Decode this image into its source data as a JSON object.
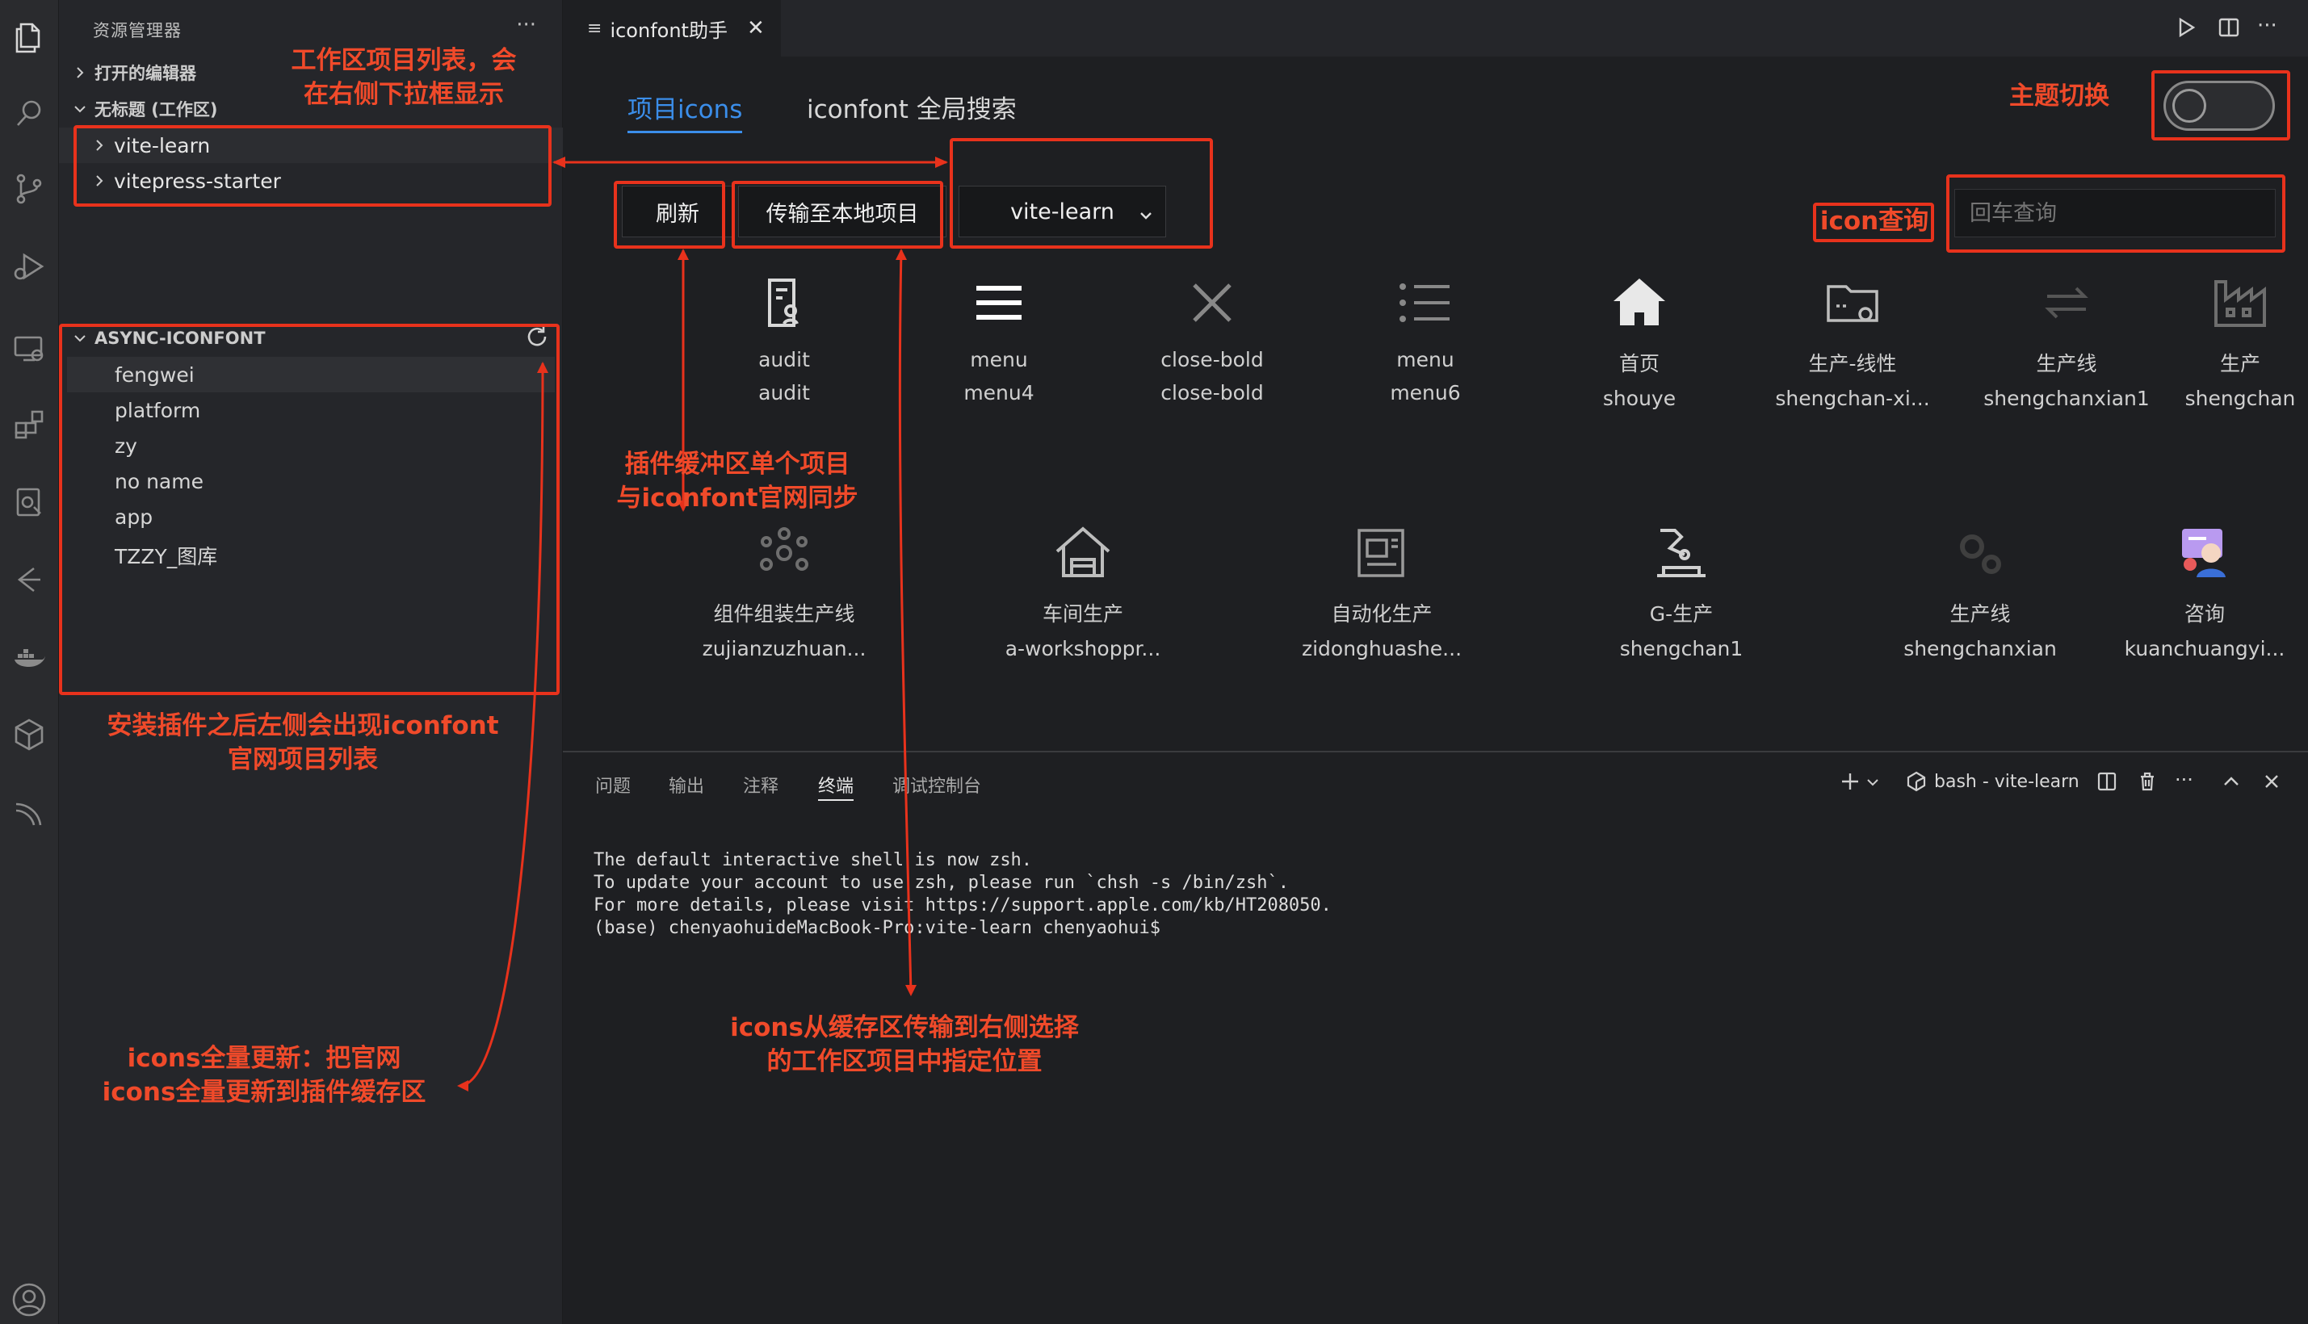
{
  "sidebar": {
    "title": "资源管理器",
    "more": "···",
    "open_editors": "打开的编辑器",
    "workspace": "无标题 (工作区)",
    "workspace_projects": [
      "vite-learn",
      "vitepress-starter"
    ],
    "plugin_section": "ASYNC-ICONFONT",
    "plugin_projects": [
      "fengwei",
      "platform",
      "zy",
      "no name",
      "app",
      "TZZY_图库"
    ]
  },
  "editor": {
    "tab_label": "iconfont助手",
    "tab_close": "✕"
  },
  "webview": {
    "tab_projects": "项目icons",
    "tab_global_search": "iconfont 全局搜索",
    "refresh_button": "刷新",
    "transfer_button": "传输至本地项目",
    "project_select_value": "vite-learn",
    "search_placeholder": "回车查询",
    "icons": [
      {
        "name": "audit",
        "code": "audit",
        "icon": "audit-icon"
      },
      {
        "name": "menu",
        "code": "menu4",
        "icon": "menu-icon"
      },
      {
        "name": "close-bold",
        "code": "close-bold",
        "icon": "close-bold-icon"
      },
      {
        "name": "menu",
        "code": "menu6",
        "icon": "list-menu-icon"
      },
      {
        "name": "首页",
        "code": "shouye",
        "icon": "home-icon"
      },
      {
        "name": "生产-线性",
        "code": "shengchan-xi...",
        "icon": "folder-gear-icon"
      },
      {
        "name": "生产线",
        "code": "shengchanxian1",
        "icon": "transfer-arrows-icon"
      },
      {
        "name": "生产",
        "code": "shengchan",
        "icon": "factory-icon"
      },
      {
        "name": "组件组装生产线",
        "code": "zujianzuzhuan...",
        "icon": "component-assembly-icon"
      },
      {
        "name": "车间生产",
        "code": "a-workshoppr...",
        "icon": "workshop-icon"
      },
      {
        "name": "自动化生产",
        "code": "zidonghuashe...",
        "icon": "automation-icon"
      },
      {
        "name": "G-生产",
        "code": "shengchan1",
        "icon": "robot-arm-icon"
      },
      {
        "name": "生产线",
        "code": "shengchanxian",
        "icon": "gears-icon"
      },
      {
        "name": "咨询",
        "code": "kuanchuangyi...",
        "icon": "consult-icon"
      }
    ]
  },
  "panel": {
    "tabs": [
      "问题",
      "输出",
      "注释",
      "终端",
      "调试控制台"
    ],
    "terminal_name": "bash - vite-learn",
    "terminal_lines": [
      "The default interactive shell is now zsh.",
      "To update your account to use zsh, please run `chsh -s /bin/zsh`.",
      "For more details, please visit https://support.apple.com/kb/HT208050.",
      "(base) chenyaohuideMacBook-Pro:vite-learn chenyaohui$"
    ]
  },
  "annotations": {
    "workspace_list": "工作区项目列表，会\n在右侧下拉框显示",
    "theme_switch": "主题切换",
    "icon_query": "icon查询",
    "plugin_sync": "插件缓冲区单个项目\n与iconfont官网同步",
    "plugin_list": "安装插件之后左侧会出现iconfont\n官网项目列表",
    "full_update": "icons全量更新：把官网\nicons全量更新到插件缓存区",
    "transfer": "icons从缓存区传输到右侧选择\n的工作区项目中指定位置"
  },
  "colors": {
    "accent_blue": "#3b8eea",
    "annotation_red": "#e8321c",
    "background": "#1e1f22",
    "sidebar": "#25262a"
  }
}
